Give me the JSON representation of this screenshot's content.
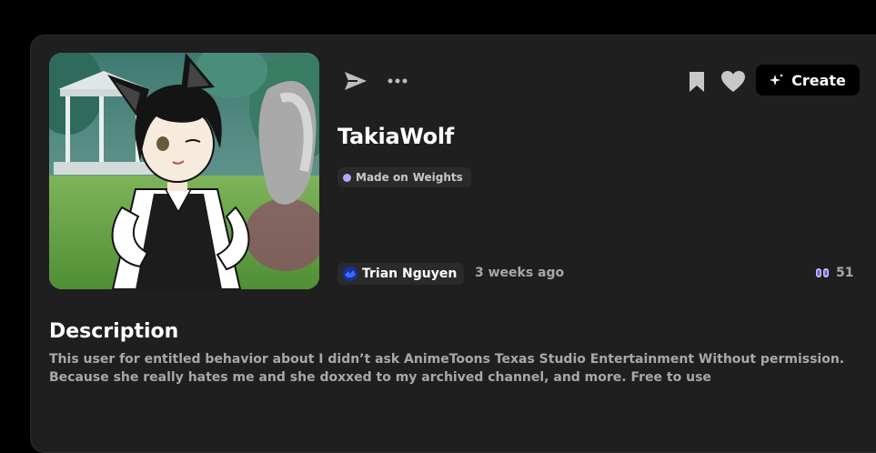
{
  "model": {
    "title": "TakiaWolf",
    "badge_prefix": "Made on",
    "badge_platform": "Weights",
    "author": "Trian Nguyen",
    "time_ago": "3 weeks ago",
    "uses_count": "51"
  },
  "toolbar": {
    "create_label": "Create",
    "icons": [
      "send-icon",
      "more-icon",
      "bookmark-icon",
      "heart-icon",
      "sparkle-icon"
    ]
  },
  "description": {
    "heading": "Description",
    "text": "This user for entitled behavior about I didn’t ask AnimeToons Texas Studio Entertainment Without permission. Because she really hates me and she doxxed to my archived channel, and more. Free to use"
  },
  "colors": {
    "page_bg": "#000000",
    "card_bg": "#1f1f1f",
    "badge_dot": "#b6a6ff",
    "muted_text": "#a8a8a8"
  }
}
